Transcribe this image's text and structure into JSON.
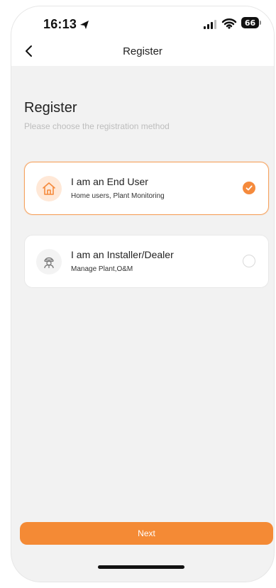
{
  "status_bar": {
    "time": "16:13",
    "battery": "66",
    "icons": [
      "location-arrow-icon",
      "cellular-signal-icon",
      "wifi-icon",
      "battery-icon"
    ]
  },
  "nav": {
    "title": "Register",
    "back_icon": "chevron-left-icon"
  },
  "page": {
    "title": "Register",
    "subtitle": "Please choose the registration method"
  },
  "options": [
    {
      "title": "I am an End User",
      "description": "Home users,  Plant Monitoring",
      "icon": "home-icon",
      "selected": true
    },
    {
      "title": "I am an Installer/Dealer",
      "description": "Manage Plant,O&M",
      "icon": "worker-icon",
      "selected": false
    }
  ],
  "actions": {
    "next_label": "Next"
  },
  "colors": {
    "accent": "#f48a35",
    "accent_light": "#ffe8d7",
    "background": "#f2f2f2",
    "selected_border": "#f6a35f"
  }
}
